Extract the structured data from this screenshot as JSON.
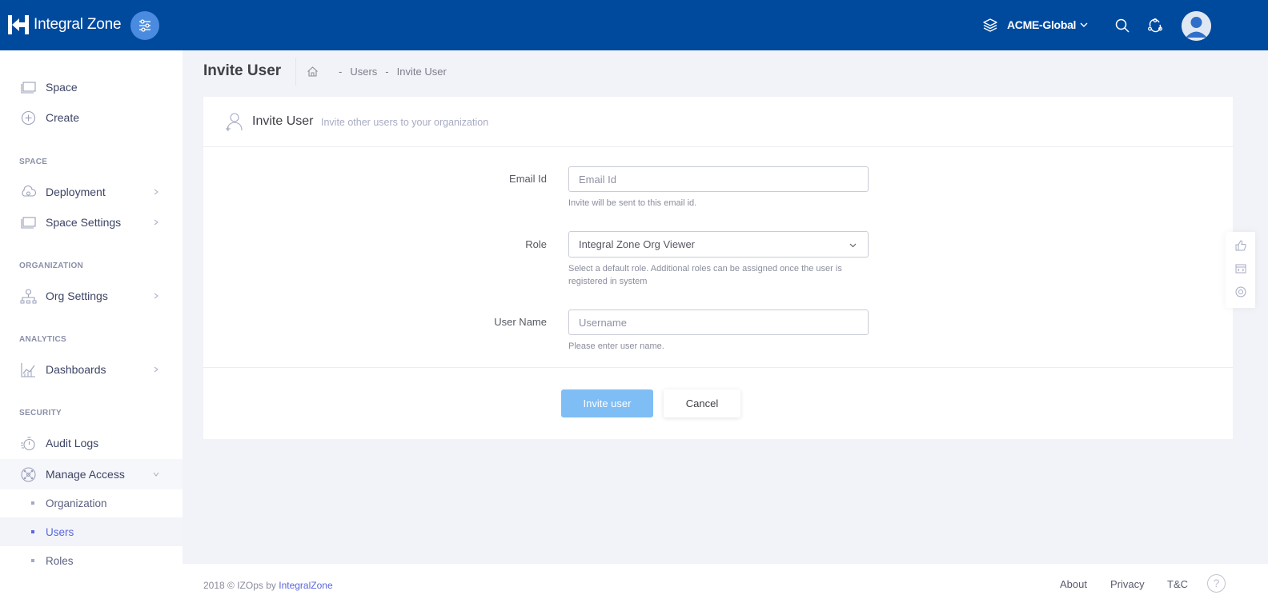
{
  "header": {
    "brand": "Integral Zone",
    "org_name": "ACME-Global"
  },
  "sidebar": {
    "items": [
      {
        "label": "Space",
        "icon": "space-icon"
      },
      {
        "label": "Create",
        "icon": "plus-circle-icon"
      }
    ],
    "sections": {
      "space": "SPACE",
      "organization": "ORGANIZATION",
      "analytics": "ANALYTICS",
      "security": "SECURITY"
    },
    "space_items": [
      {
        "label": "Deployment",
        "icon": "cloud-icon"
      },
      {
        "label": "Space Settings",
        "icon": "space-settings-icon"
      }
    ],
    "org_items": [
      {
        "label": "Org Settings",
        "icon": "org-chart-icon"
      }
    ],
    "analytics_items": [
      {
        "label": "Dashboards",
        "icon": "chart-icon"
      }
    ],
    "security_items": [
      {
        "label": "Audit Logs",
        "icon": "stopwatch-icon"
      },
      {
        "label": "Manage Access",
        "icon": "network-icon"
      }
    ],
    "manage_access_sub": [
      {
        "label": "Organization",
        "active": false
      },
      {
        "label": "Users",
        "active": true
      },
      {
        "label": "Roles",
        "active": false
      }
    ]
  },
  "subheader": {
    "title": "Invite User",
    "breadcrumbs": [
      "-",
      "Users",
      "-",
      "Invite User"
    ]
  },
  "portlet": {
    "title": "Invite User",
    "description": "Invite other users to your organization"
  },
  "form": {
    "email": {
      "label": "Email Id",
      "placeholder": "Email Id",
      "value": "",
      "help": "Invite will be sent to this email id."
    },
    "role": {
      "label": "Role",
      "selected": "Integral Zone Org Viewer",
      "help": "Select a default role. Additional roles can be assigned once the user is registered in system"
    },
    "username": {
      "label": "User Name",
      "placeholder": "Username",
      "value": "",
      "help": "Please enter user name."
    },
    "invite_label": "Invite user",
    "cancel_label": "Cancel"
  },
  "footer": {
    "copyright": "2018 © IZOps by",
    "brand_link": "IntegralZone",
    "links": [
      "About",
      "Privacy",
      "T&C"
    ],
    "help": "?"
  },
  "colors": {
    "header_bg": "#004a9e",
    "accent": "#5867dd",
    "invite_button": "#7fbdf5"
  }
}
